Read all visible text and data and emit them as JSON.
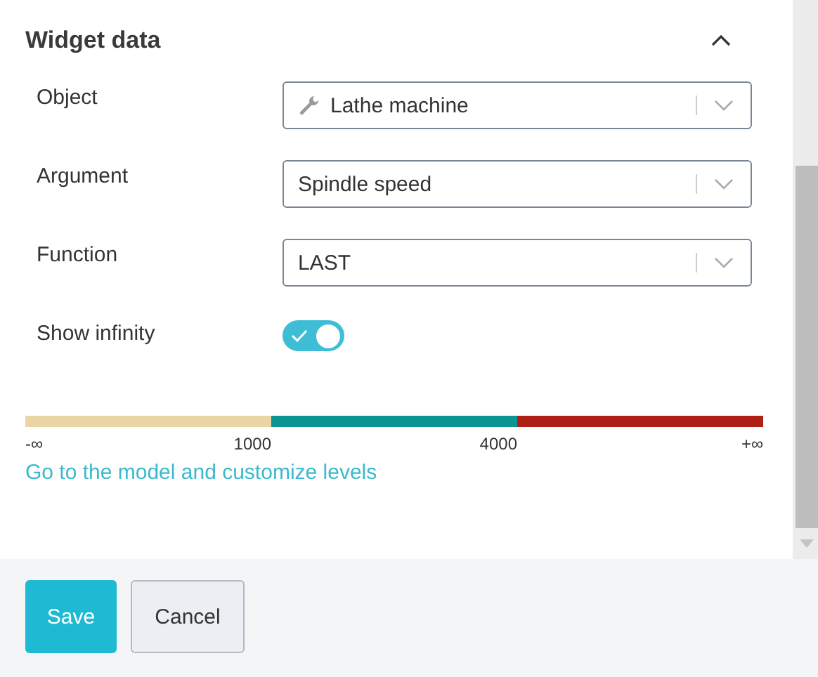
{
  "section": {
    "title": "Widget data",
    "expanded": true
  },
  "fields": [
    {
      "label": "Object",
      "value": "Lathe machine",
      "has_icon": true
    },
    {
      "label": "Argument",
      "value": "Spindle speed",
      "has_icon": false
    },
    {
      "label": "Function",
      "value": "LAST",
      "has_icon": false
    }
  ],
  "toggle": {
    "label": "Show infinity",
    "on": true
  },
  "levels": {
    "segments": [
      {
        "color": "#ead6a4"
      },
      {
        "color": "#0c9394"
      },
      {
        "color": "#b01f15"
      }
    ],
    "ticks": [
      "-∞",
      "1000",
      "4000",
      "+∞"
    ]
  },
  "link": "Go to the model and customize levels",
  "buttons": [
    {
      "label": "Save",
      "kind": "primary"
    },
    {
      "label": "Cancel",
      "kind": "secondary"
    }
  ]
}
